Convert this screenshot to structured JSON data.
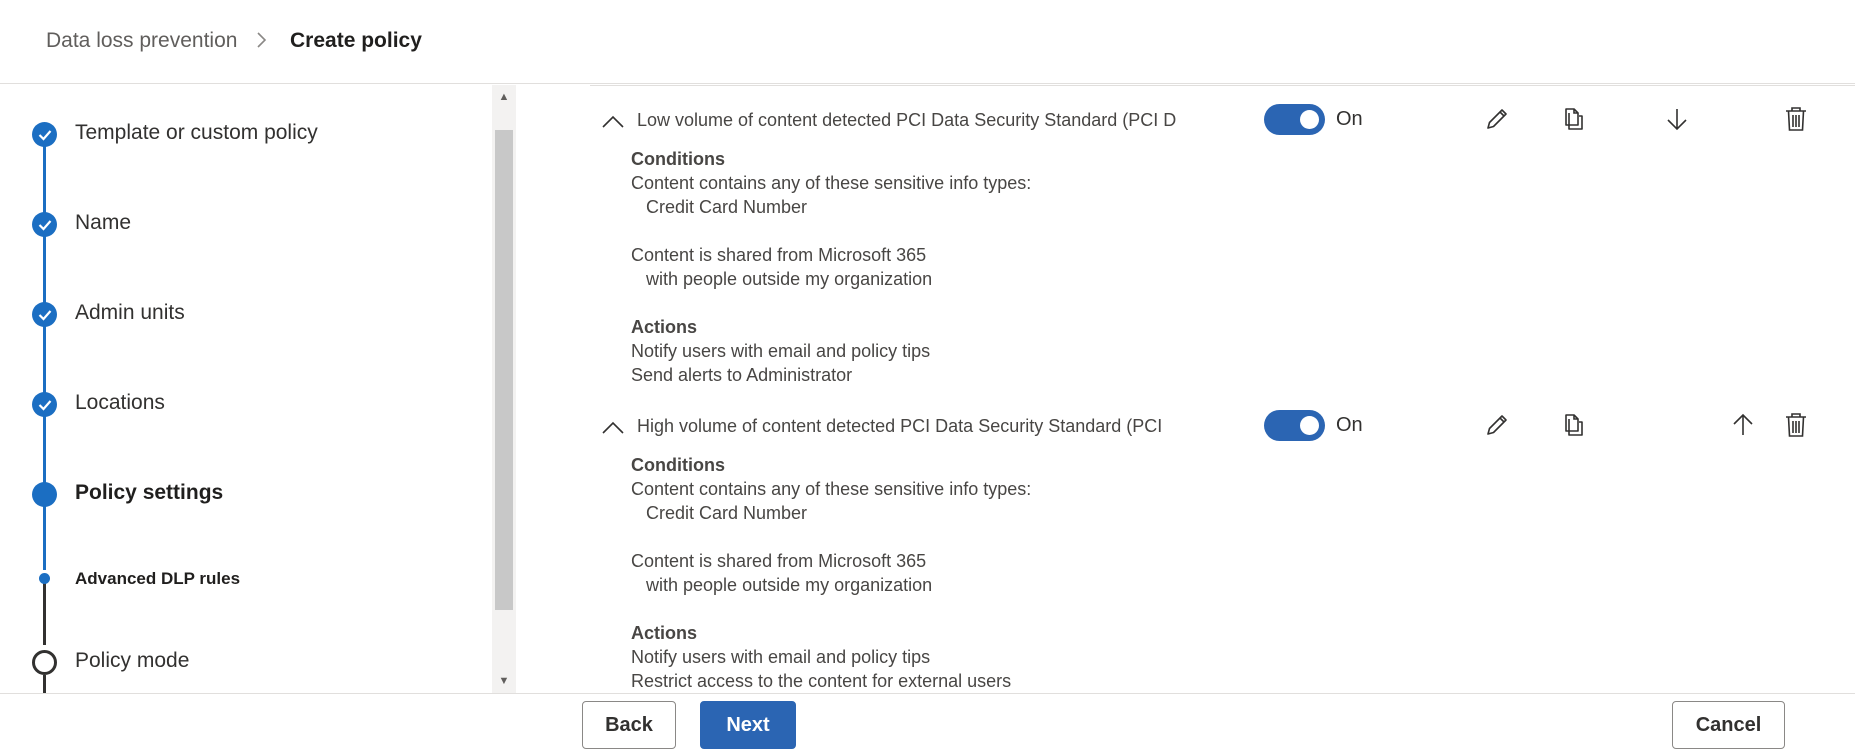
{
  "breadcrumb": {
    "parent": "Data loss prevention",
    "separator": ">",
    "current": "Create policy"
  },
  "steps": [
    {
      "label": "Template or custom policy",
      "state": "complete"
    },
    {
      "label": "Name",
      "state": "complete"
    },
    {
      "label": "Admin units",
      "state": "complete"
    },
    {
      "label": "Locations",
      "state": "complete"
    },
    {
      "label": "Policy settings",
      "state": "current"
    },
    {
      "label": "Advanced DLP rules",
      "state": "current-substep"
    },
    {
      "label": "Policy mode",
      "state": "incomplete"
    }
  ],
  "rules": [
    {
      "title": "Low volume of content detected PCI Data Security Standard (PCI D",
      "toggle_label": "On",
      "conditions_heading": "Conditions",
      "condition_1": "Content contains any of these sensitive info types:",
      "condition_1_value": "Credit Card Number",
      "condition_2": "Content is shared from Microsoft 365",
      "condition_2_value": "with people outside my organization",
      "actions_heading": "Actions",
      "action_1": "Notify users with email and policy tips",
      "action_2": "Send alerts to Administrator"
    },
    {
      "title": "High volume of content detected PCI Data Security Standard (PCI",
      "toggle_label": "On",
      "conditions_heading": "Conditions",
      "condition_1": "Content contains any of these sensitive info types:",
      "condition_1_value": "Credit Card Number",
      "condition_2": "Content is shared from Microsoft 365",
      "condition_2_value": "with people outside my organization",
      "actions_heading": "Actions",
      "action_1": "Notify users with email and policy tips",
      "action_2": "Restrict access to the content for external users"
    }
  ],
  "footer": {
    "back_label": "Back",
    "next_label": "Next",
    "cancel_label": "Cancel"
  },
  "colors": {
    "accent": "#2b65b3",
    "step_complete": "#1b6ec2"
  }
}
